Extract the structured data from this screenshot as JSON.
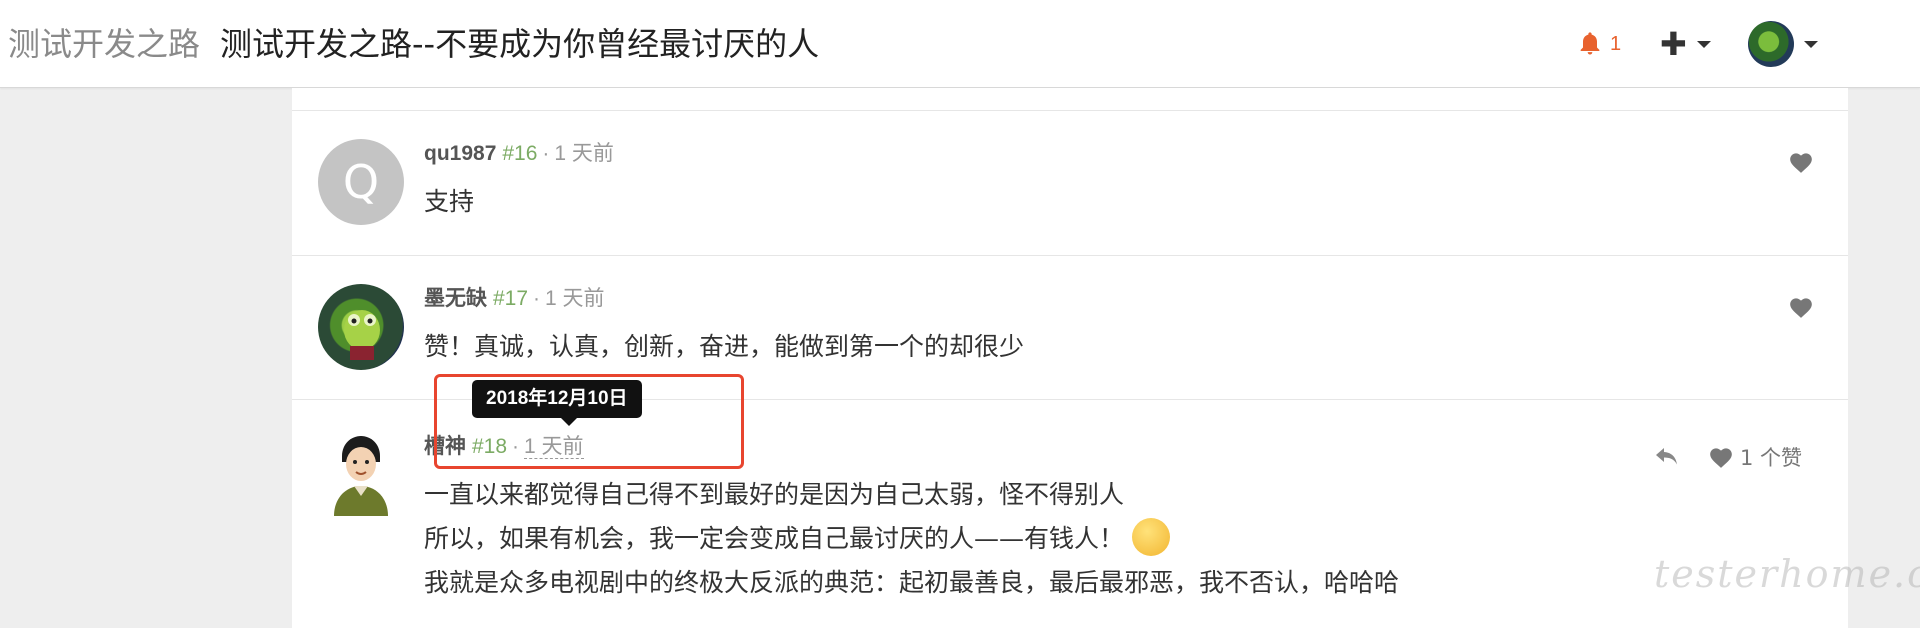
{
  "navbar": {
    "node_name": "测试开发之路",
    "topic_title": "测试开发之路--不要成为你曾经最讨厌的人",
    "notification_count": "1",
    "plus_label": "✚"
  },
  "replies": [
    {
      "avatar_letter": "Q",
      "username": "qu1987",
      "floor": "#16",
      "separator": "·",
      "time": "1 天前",
      "lines": [
        "支持"
      ]
    },
    {
      "username": "墨无缺",
      "floor": "#17",
      "separator": "·",
      "time": "1 天前",
      "lines": [
        "赞！真诚，认真，创新，奋进，能做到第一个的却很少"
      ]
    },
    {
      "username": "槽神",
      "floor": "#18",
      "separator": "·",
      "time": "1 天前",
      "like_label": "1 个赞",
      "lines": [
        "一直以来都觉得自己得不到最好的是因为自己太弱，怪不得别人",
        "所以，如果有机会，我一定会变成自己最讨厌的人——有钱人！",
        "我就是众多电视剧中的终极大反派的典范：起初最善良，最后最邪恶，我不否认，哈哈哈"
      ]
    }
  ],
  "tooltip": "2018年12月10日",
  "watermark": "testerhome.com",
  "colors": {
    "accent_orange": "#e8622e",
    "floor_green": "#7cab64",
    "highlight_red": "#e8452f"
  }
}
